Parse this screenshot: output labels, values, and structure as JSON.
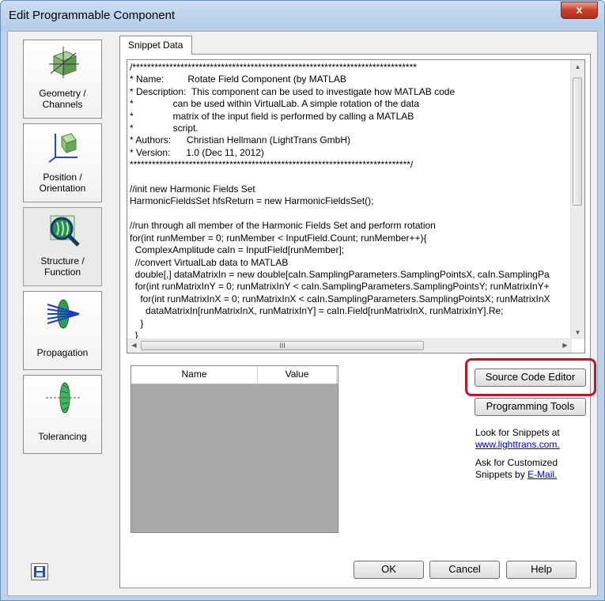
{
  "window": {
    "title": "Edit Programmable Component",
    "close_label": "x"
  },
  "nav": {
    "items": [
      {
        "label_line1": "Geometry /",
        "label_line2": "Channels",
        "icon": "geometry-cube-icon"
      },
      {
        "label_line1": "Position /",
        "label_line2": "Orientation",
        "icon": "position-axes-icon"
      },
      {
        "label_line1": "Structure /",
        "label_line2": "Function",
        "icon": "structure-magnifier-icon"
      },
      {
        "label_line1": "Propagation",
        "label_line2": "",
        "icon": "propagation-lens-icon"
      },
      {
        "label_line1": "Tolerancing",
        "label_line2": "",
        "icon": "tolerancing-lens-icon"
      }
    ]
  },
  "tab": {
    "label": "Snippet Data"
  },
  "code_lines": [
    "/*****************************************************************************",
    "* Name:         Rotate Field Component (by MATLAB",
    "* Description:  This component can be used to investigate how MATLAB code",
    "*               can be used within VirtualLab. A simple rotation of the data",
    "*               matrix of the input field is performed by calling a MATLAB",
    "*               script.",
    "* Authors:      Christian Hellmann (LightTrans GmbH)",
    "* Version:      1.0 (Dec 11, 2012)",
    "****************************************************************************/",
    "",
    "//init new Harmonic Fields Set",
    "HarmonicFieldsSet hfsReturn = new HarmonicFieldsSet();",
    "",
    "//run through all member of the Harmonic Fields Set and perform rotation",
    "for(int runMember = 0; runMember < InputField.Count; runMember++){",
    "  ComplexAmplitude caIn = InputField[runMember];",
    "  //convert VirtualLab data to MATLAB",
    "  double[,] dataMatrixIn = new double[caIn.SamplingParameters.SamplingPointsX, caIn.SamplingPa",
    "  for(int runMatrixInY = 0; runMatrixInY < caIn.SamplingParameters.SamplingPointsY; runMatrixInY+",
    "    for(int runMatrixInX = 0; runMatrixInX < caIn.SamplingParameters.SamplingPointsX; runMatrixInX",
    "      dataMatrixIn[runMatrixInX, runMatrixInY] = caIn.Field[runMatrixInX, runMatrixInY].Re;",
    "    }",
    "  }"
  ],
  "grid": {
    "col_name": "Name",
    "col_value": "Value"
  },
  "buttons": {
    "source_code_editor": "Source Code Editor",
    "programming_tools": "Programming Tools",
    "ok": "OK",
    "cancel": "Cancel",
    "help": "Help"
  },
  "info": {
    "snippets_text": "Look for Snippets at",
    "snippets_link": "www.lighttrans.com.",
    "custom_text_1": "Ask for Customized",
    "custom_text_2": "Snippets by",
    "custom_link": "E-Mail."
  },
  "colors": {
    "highlight": "#b01c2e",
    "link": "#0000cc",
    "titlebar": "#b9d1ea"
  }
}
